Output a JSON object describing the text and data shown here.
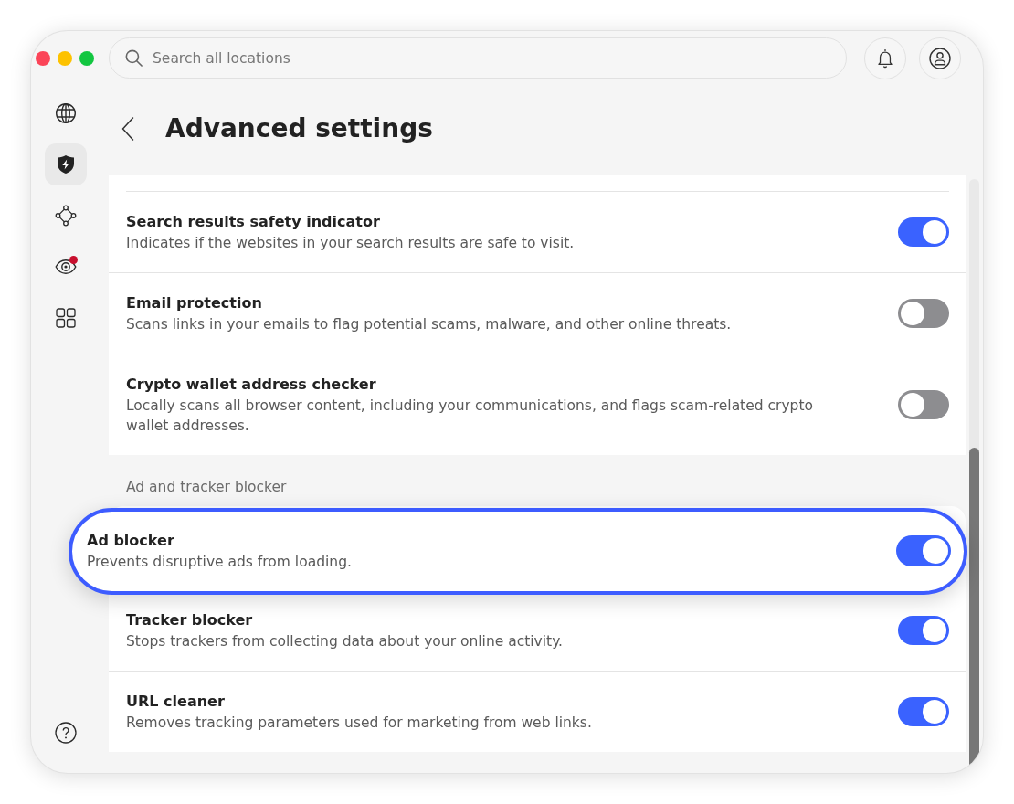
{
  "search": {
    "placeholder": "Search all locations"
  },
  "sidebar": {
    "items": [
      {
        "selected": false,
        "notification": false
      },
      {
        "selected": true,
        "notification": false
      },
      {
        "selected": false,
        "notification": false
      },
      {
        "selected": false,
        "notification": true
      },
      {
        "selected": false,
        "notification": false
      }
    ]
  },
  "page": {
    "title": "Advanced settings"
  },
  "sections": [
    {
      "rows": [
        {
          "title": "Search results safety indicator",
          "description": "Indicates if the websites in your search results are safe to visit.",
          "on": true,
          "highlighted": false
        },
        {
          "title": "Email protection",
          "description": "Scans links in your emails to flag potential scams, malware, and other online threats.",
          "on": false,
          "highlighted": false
        },
        {
          "title": "Crypto wallet address checker",
          "description": "Locally scans all browser content, including your communications, and flags scam-related crypto wallet addresses.",
          "on": false,
          "highlighted": false
        }
      ]
    },
    {
      "heading": "Ad and tracker blocker",
      "rows": [
        {
          "title": "Ad blocker",
          "description": "Prevents disruptive ads from loading.",
          "on": true,
          "highlighted": true
        },
        {
          "title": "Tracker blocker",
          "description": "Stops trackers from collecting data about your online activity.",
          "on": true,
          "highlighted": false
        },
        {
          "title": "URL cleaner",
          "description": "Removes tracking parameters used for marketing from web links.",
          "on": true,
          "highlighted": false
        }
      ]
    }
  ]
}
